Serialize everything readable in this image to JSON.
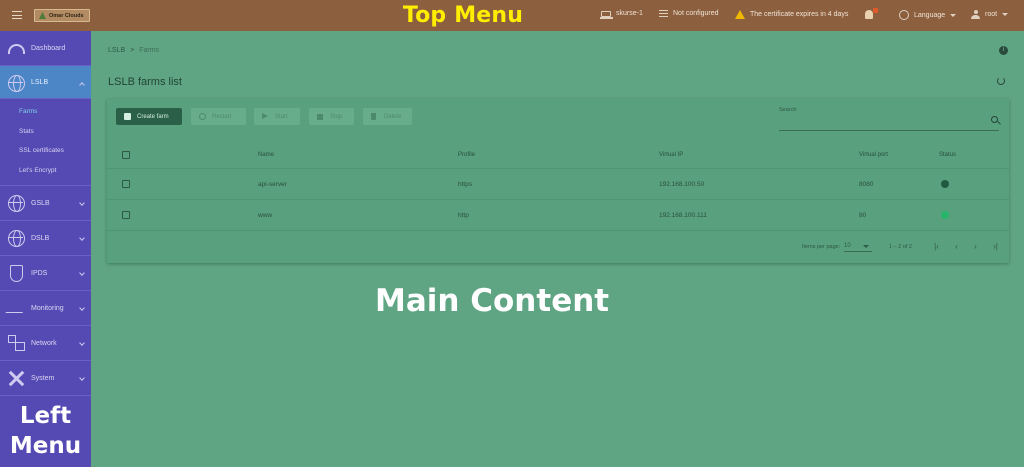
{
  "topbar": {
    "logo_text": "Omar Clouds",
    "overlay_label": "Top Menu",
    "host": "skurse-1",
    "config_status": "Not configured",
    "cert_warning": "The certificate expires in 4 days",
    "language_label": "Language",
    "user_label": "root"
  },
  "sidebar": {
    "overlay_label_line1": "Left",
    "overlay_label_line2": "Menu",
    "items": [
      {
        "label": "Dashboard",
        "icon": "gauge-icon"
      },
      {
        "label": "LSLB",
        "icon": "globe-icon"
      },
      {
        "label": "GSLB",
        "icon": "globe-icon"
      },
      {
        "label": "DSLB",
        "icon": "globe-icon"
      },
      {
        "label": "IPDS",
        "icon": "shield-icon"
      },
      {
        "label": "Monitoring",
        "icon": "wave-icon"
      },
      {
        "label": "Network",
        "icon": "network-icon"
      },
      {
        "label": "System",
        "icon": "tools-icon"
      }
    ],
    "lslb_sub": [
      "Farms",
      "Stats",
      "SSL certificates",
      "Let's Encrypt"
    ]
  },
  "main": {
    "overlay_label": "Main Content",
    "breadcrumb": {
      "root": "LSLB",
      "sep": ">",
      "current": "Farms"
    },
    "title": "LSLB farms list",
    "toolbar": {
      "create": "Create farm",
      "restart": "Restart",
      "start": "Start",
      "stop": "Stop",
      "delete": "Delete"
    },
    "search": {
      "label": "Search",
      "value": ""
    },
    "table": {
      "headers": [
        "Name",
        "Profile",
        "Virtual IP",
        "Virtual port",
        "Status"
      ],
      "rows": [
        {
          "name": "api-server",
          "profile": "https",
          "vip": "192.168.100.50",
          "port": "8080",
          "status_color": "#1f5a40"
        },
        {
          "name": "www",
          "profile": "http",
          "vip": "192.168.100.111",
          "port": "80",
          "status_color": "#27b56a"
        }
      ]
    },
    "paginator": {
      "label": "Items per page:",
      "page_size": "10",
      "range": "1 – 2 of 2"
    }
  },
  "colors": {
    "topbar": "#8c5f3f",
    "sidebar": "#5549b3",
    "sidebar_active": "#4c86c7",
    "main_bg": "#5fa583",
    "primary_button": "#2a5f48",
    "overlay_top_label": "#ffee00"
  }
}
